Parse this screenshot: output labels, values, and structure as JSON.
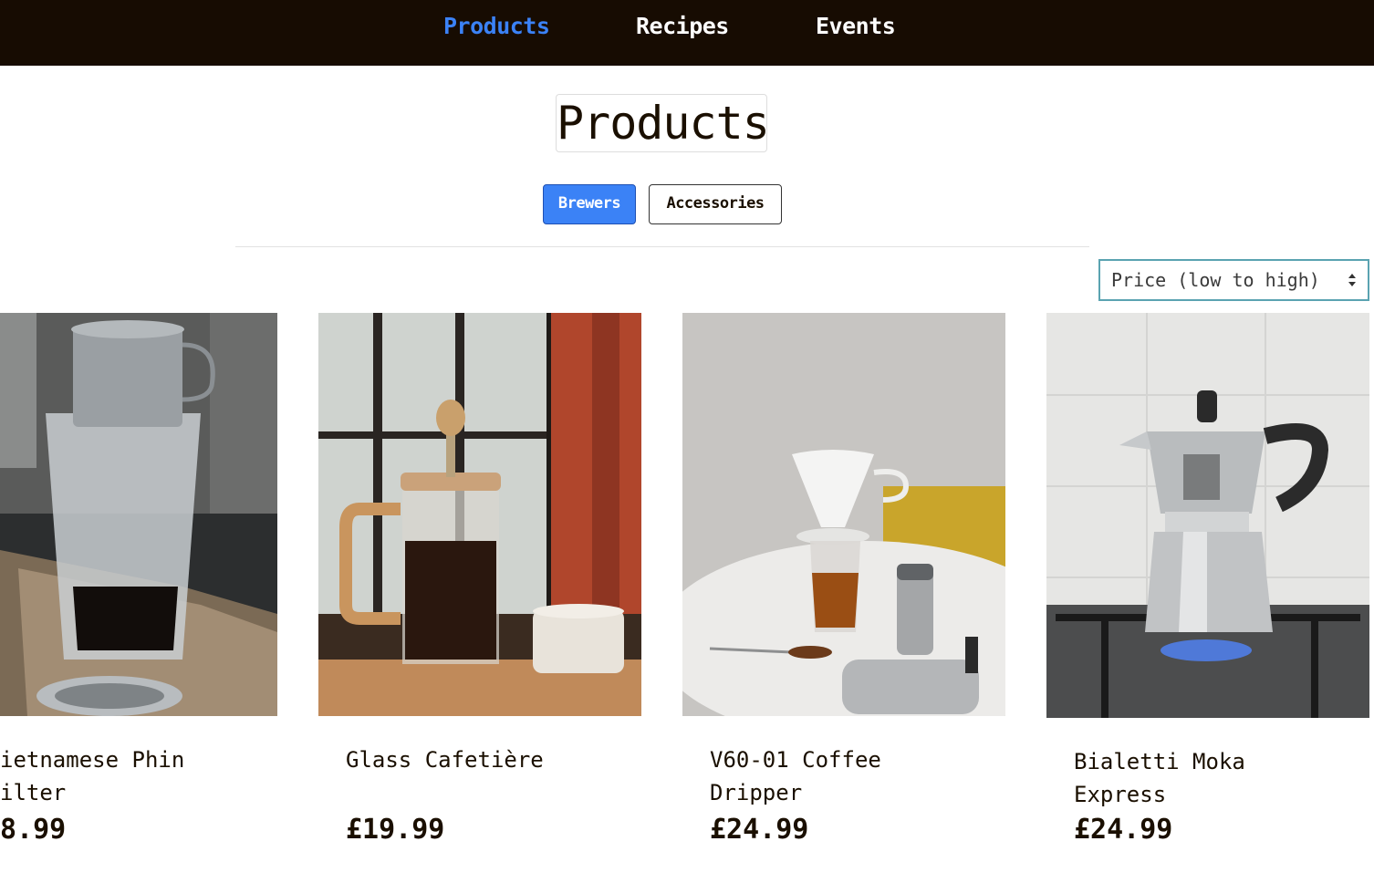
{
  "nav": {
    "items": [
      {
        "label": "Products",
        "active": true
      },
      {
        "label": "Recipes",
        "active": false
      },
      {
        "label": "Events",
        "active": false
      }
    ]
  },
  "page": {
    "title": "Products"
  },
  "tabs": [
    {
      "label": "Brewers",
      "active": true
    },
    {
      "label": "Accessories",
      "active": false
    }
  ],
  "sort": {
    "selected": "Price (low to high)"
  },
  "products": [
    {
      "name": "ietnamese Phin\nilter",
      "price": "8.99",
      "image": "phin-filter-photo"
    },
    {
      "name": "Glass Cafetière",
      "price": "£19.99",
      "image": "glass-cafetiere-photo"
    },
    {
      "name": "V60-01 Coffee\nDripper",
      "price": "£24.99",
      "image": "v60-dripper-photo"
    },
    {
      "name": "Bialetti Moka\nExpress",
      "price": "£24.99",
      "image": "moka-express-photo"
    }
  ],
  "colors": {
    "nav_bg": "#170c02",
    "accent": "#3b82f6",
    "text": "#1a0f00"
  }
}
